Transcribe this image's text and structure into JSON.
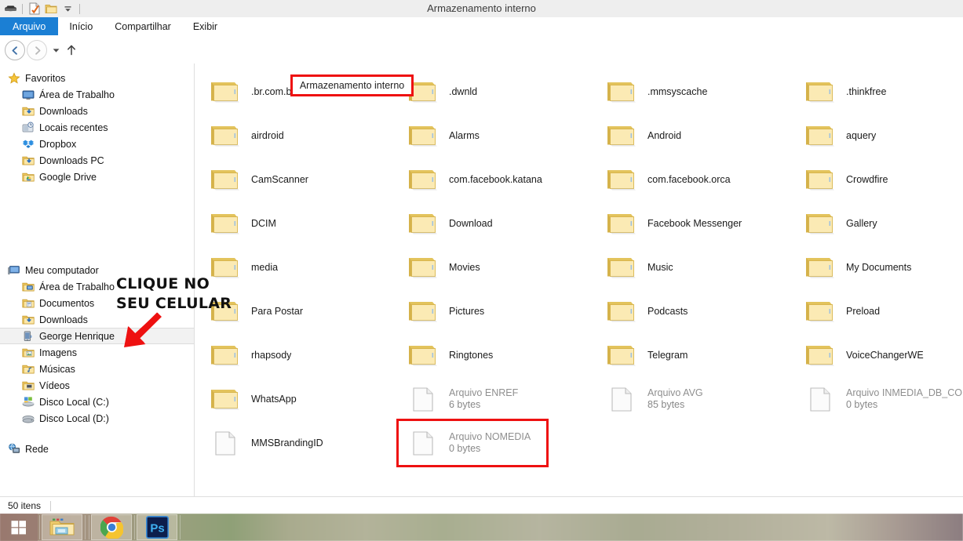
{
  "window": {
    "title": "Armazenamento interno"
  },
  "quick_access_toolbar": {
    "items": [
      {
        "name": "drive-icon",
        "label": ""
      },
      {
        "name": "properties-icon",
        "label": ""
      },
      {
        "name": "new-folder-icon",
        "label": ""
      },
      {
        "name": "chevron-down-icon",
        "label": ""
      }
    ]
  },
  "ribbon": {
    "tabs": [
      {
        "label": "Arquivo",
        "active": true
      },
      {
        "label": "Início",
        "active": false
      },
      {
        "label": "Compartilhar",
        "active": false
      },
      {
        "label": "Exibir",
        "active": false
      }
    ]
  },
  "navigation": {
    "back_glyph": "←",
    "forward_glyph": "→",
    "recent_glyph": "▾",
    "up_glyph": "↑",
    "breadcrumb": [
      {
        "label": "Meu computador",
        "highlighted": false
      },
      {
        "label": "George Henrique",
        "highlighted": false
      },
      {
        "label": "Armazenamento interno",
        "highlighted": true
      }
    ]
  },
  "sidebar": {
    "groups": [
      {
        "name": "favoritos",
        "header": {
          "label": "Favoritos",
          "icon": "star-icon"
        },
        "items": [
          {
            "label": "Área de Trabalho",
            "icon": "desktop-icon"
          },
          {
            "label": "Downloads",
            "icon": "downloads-folder-icon"
          },
          {
            "label": "Locais recentes",
            "icon": "recent-places-icon"
          },
          {
            "label": "Dropbox",
            "icon": "dropbox-icon"
          },
          {
            "label": "Downloads PC",
            "icon": "downloads-folder-icon"
          },
          {
            "label": "Google Drive",
            "icon": "google-drive-icon"
          }
        ]
      },
      {
        "name": "meu-computador",
        "header": {
          "label": "Meu computador",
          "icon": "computer-icon"
        },
        "items": [
          {
            "label": "Área de Trabalho",
            "icon": "desktop-folder-icon",
            "selected": false
          },
          {
            "label": "Documentos",
            "icon": "documents-folder-icon",
            "selected": false
          },
          {
            "label": "Downloads",
            "icon": "downloads-folder-icon",
            "selected": false
          },
          {
            "label": "George Henrique",
            "icon": "phone-device-icon",
            "selected": true
          },
          {
            "label": "Imagens",
            "icon": "pictures-folder-icon",
            "selected": false
          },
          {
            "label": "Músicas",
            "icon": "music-folder-icon",
            "selected": false
          },
          {
            "label": "Vídeos",
            "icon": "videos-folder-icon",
            "selected": false
          },
          {
            "label": "Disco Local (C:)",
            "icon": "system-drive-icon",
            "selected": false
          },
          {
            "label": "Disco Local (D:)",
            "icon": "local-drive-icon",
            "selected": false
          }
        ]
      },
      {
        "name": "rede",
        "header": {
          "label": "Rede",
          "icon": "network-icon"
        },
        "items": []
      }
    ]
  },
  "files": {
    "columns": [
      {
        "items": [
          {
            "name": ".br.com.brainweb.ifood",
            "type": "folder"
          },
          {
            "name": "airdroid",
            "type": "folder"
          },
          {
            "name": "CamScanner",
            "type": "folder"
          },
          {
            "name": "DCIM",
            "type": "folder"
          },
          {
            "name": "media",
            "type": "folder"
          },
          {
            "name": "Para Postar",
            "type": "folder"
          },
          {
            "name": "rhapsody",
            "type": "folder"
          },
          {
            "name": "WhatsApp",
            "type": "folder"
          },
          {
            "name": "MMSBrandingID",
            "type": "file",
            "size": ""
          }
        ]
      },
      {
        "items": [
          {
            "name": ".dwnld",
            "type": "folder"
          },
          {
            "name": "Alarms",
            "type": "folder"
          },
          {
            "name": "com.facebook.katana",
            "type": "folder"
          },
          {
            "name": "Download",
            "type": "folder"
          },
          {
            "name": "Movies",
            "type": "folder"
          },
          {
            "name": "Pictures",
            "type": "folder"
          },
          {
            "name": "Ringtones",
            "type": "folder"
          },
          {
            "name": "Arquivo ENREF",
            "type": "file",
            "size": "6 bytes"
          },
          {
            "name": "Arquivo NOMEDIA",
            "type": "file",
            "size": "0 bytes",
            "highlighted": true
          }
        ]
      },
      {
        "items": [
          {
            "name": ".mmsyscache",
            "type": "folder"
          },
          {
            "name": "Android",
            "type": "folder"
          },
          {
            "name": "com.facebook.orca",
            "type": "folder"
          },
          {
            "name": "Facebook Messenger",
            "type": "folder"
          },
          {
            "name": "Music",
            "type": "folder"
          },
          {
            "name": "Podcasts",
            "type": "folder"
          },
          {
            "name": "Telegram",
            "type": "folder"
          },
          {
            "name": "Arquivo AVG",
            "type": "file",
            "size": "85 bytes"
          }
        ]
      },
      {
        "items": [
          {
            "name": ".thinkfree",
            "type": "folder"
          },
          {
            "name": "aquery",
            "type": "folder"
          },
          {
            "name": "Crowdfire",
            "type": "folder"
          },
          {
            "name": "Gallery",
            "type": "folder"
          },
          {
            "name": "My Documents",
            "type": "folder"
          },
          {
            "name": "Preload",
            "type": "folder"
          },
          {
            "name": "VoiceChangerWE",
            "type": "folder"
          },
          {
            "name": "Arquivo INMEDIA_DB_COM",
            "type": "file",
            "size": "0 bytes"
          }
        ]
      }
    ]
  },
  "annotation": {
    "line1": "CLIQUE NO",
    "line2": "SEU CELULAR",
    "arrow_color": "#ee1111",
    "text_color": "#111111"
  },
  "status_bar": {
    "item_count": "50 itens"
  },
  "taskbar": {
    "items": [
      {
        "name": "start-button",
        "label": ""
      },
      {
        "name": "file-explorer-button",
        "label": ""
      },
      {
        "name": "chrome-button",
        "label": ""
      },
      {
        "name": "photoshop-button",
        "label": "Ps"
      }
    ]
  },
  "colors": {
    "accent": "#1b7fd4",
    "highlight_box": "#ee1111",
    "folder_yellow": "#f6dc8f"
  }
}
